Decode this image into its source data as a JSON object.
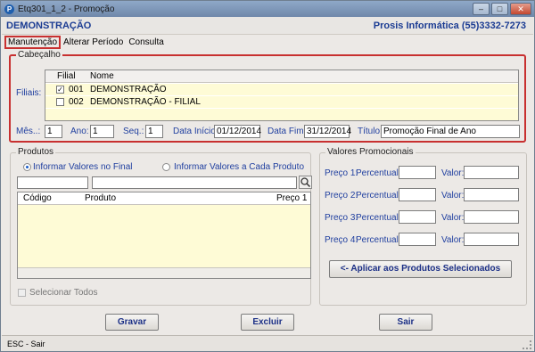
{
  "window": {
    "title": "Etq301_1_2 - Promoção",
    "minimize": "–",
    "maximize": "□",
    "close": "✕"
  },
  "header": {
    "company": "DEMONSTRAÇÃO",
    "vendor": "Prosis Informática (55)3332-7273"
  },
  "menu": [
    "Manutenção",
    "Alterar Período",
    "Consulta"
  ],
  "cabecalho": {
    "legend": "Cabeçalho",
    "filiais_label": "Filiais:",
    "columns": [
      "Filial",
      "Nome"
    ],
    "rows": [
      {
        "checked": true,
        "code": "001",
        "name": "DEMONSTRAÇÃO"
      },
      {
        "checked": false,
        "code": "002",
        "name": "DEMONSTRAÇÃO - FILIAL"
      }
    ],
    "mes_label": "Mês..:",
    "mes_value": "1",
    "ano_label": "Ano:",
    "ano_value": "1",
    "seq_label": "Seq.:",
    "seq_value": "1",
    "data_inicio_label": "Data Início:",
    "data_inicio_value": "01/12/2014",
    "data_fim_label": "Data Fim:",
    "data_fim_value": "31/12/2014",
    "titulo_label": "Título:",
    "titulo_value": "Promoção Final de Ano"
  },
  "produtos": {
    "legend": "Produtos",
    "radio_final": "Informar Valores no Final",
    "radio_cada": "Informar Valores a Cada Produto",
    "columns": [
      "Código",
      "Produto",
      "Preço 1"
    ],
    "select_all": "Selecionar Todos",
    "search_icon": "magnifier-icon"
  },
  "valores": {
    "legend": "Valores Promocionais",
    "rows": [
      {
        "preco": "Preço 1:",
        "percentual": "Percentual:",
        "valor": "Valor:"
      },
      {
        "preco": "Preço 2:",
        "percentual": "Percentual:",
        "valor": "Valor:"
      },
      {
        "preco": "Preço 3:",
        "percentual": "Percentual:",
        "valor": "Valor:"
      },
      {
        "preco": "Preço 4:",
        "percentual": "Percentual:",
        "valor": "Valor:"
      }
    ],
    "apply": "<- Aplicar aos Produtos Selecionados"
  },
  "buttons": {
    "gravar": "Gravar",
    "excluir": "Excluir",
    "sair": "Sair"
  },
  "status": "ESC - Sair"
}
